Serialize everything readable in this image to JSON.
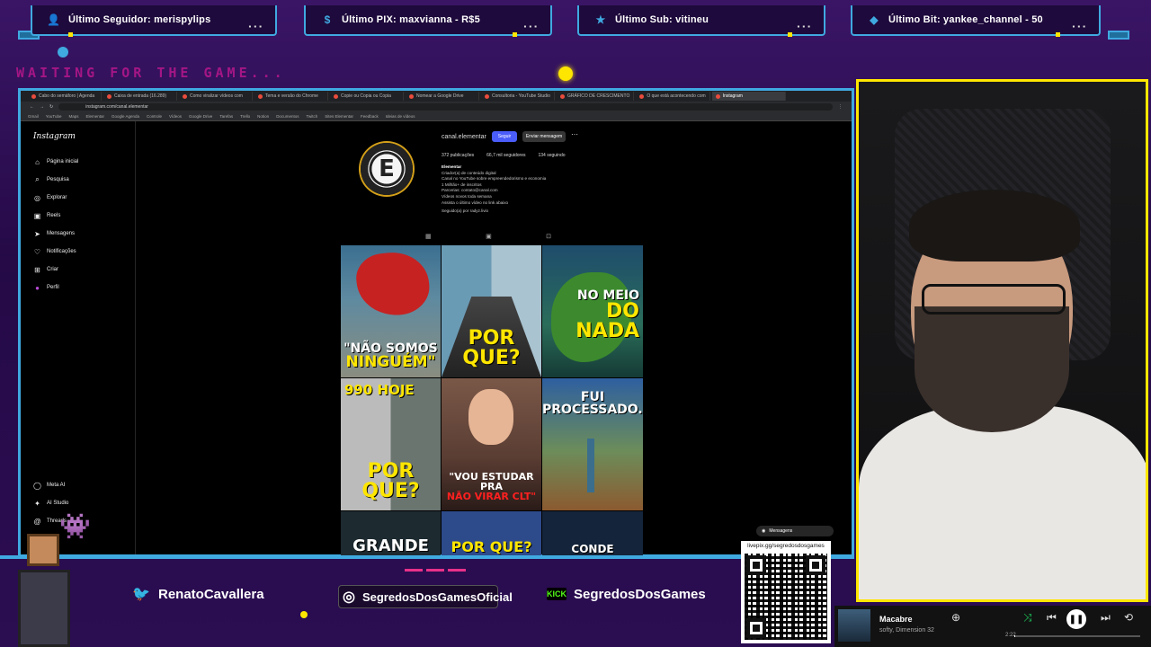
{
  "alerts": {
    "follower": {
      "label": "Último Seguidor: merispylips",
      "icon": "user-icon"
    },
    "pix": {
      "label": "Último PIX: maxvianna - R$5",
      "icon": "dollar-icon"
    },
    "sub": {
      "label": "Último Sub: vitineu",
      "icon": "star-icon"
    },
    "bit": {
      "label": "Último Bit: yankee_channel - 50",
      "icon": "diamond-icon"
    }
  },
  "overlay": {
    "waiting_text": "WAITING FOR THE GAME..."
  },
  "browser": {
    "tabs": [
      {
        "label": "Cabo do semáforo | Agenda",
        "active": false
      },
      {
        "label": "Caixa de entrada (16.289)",
        "active": false
      },
      {
        "label": "Como viralizar vídeos com",
        "active": false
      },
      {
        "label": "Tema e versão do Chrome",
        "active": false
      },
      {
        "label": "Copie ou Copia ou Copia",
        "active": false
      },
      {
        "label": "Nomear a Google Drive",
        "active": false
      },
      {
        "label": "Consultoria - YouTube Studio",
        "active": false
      },
      {
        "label": "GRÁFICO DE CRESCIMENTO",
        "active": false
      },
      {
        "label": "O que está acontecendo com",
        "active": false
      },
      {
        "label": "Instagram",
        "active": true
      }
    ],
    "url": "instagram.com/canal.elementar",
    "bookmarks": [
      "Gmail",
      "YouTube",
      "Maps",
      "Elementar",
      "Google Agenda",
      "Controle",
      "Vídeos",
      "Google Drive",
      "Tarefas",
      "Trello",
      "Notion",
      "Documentos",
      "Twitch",
      "Sites Elementar",
      "Feedback",
      "Ideias de vídeos"
    ]
  },
  "instagram": {
    "logo": "Instagram",
    "nav": [
      {
        "label": "Página inicial",
        "icon": "home-icon"
      },
      {
        "label": "Pesquisa",
        "icon": "search-icon"
      },
      {
        "label": "Explorar",
        "icon": "compass-icon"
      },
      {
        "label": "Reels",
        "icon": "reels-icon"
      },
      {
        "label": "Mensagens",
        "icon": "send-icon"
      },
      {
        "label": "Notificações",
        "icon": "heart-icon"
      },
      {
        "label": "Criar",
        "icon": "plus-icon"
      },
      {
        "label": "Perfil",
        "icon": "avatar-icon"
      }
    ],
    "bottom_nav": [
      {
        "label": "Meta AI",
        "icon": "meta-ai-icon"
      },
      {
        "label": "AI Studio",
        "icon": "ai-studio-icon"
      },
      {
        "label": "Threads",
        "icon": "threads-icon"
      }
    ],
    "profile": {
      "username": "canal.elementar",
      "avatar_letter": "E",
      "follow_label": "Seguir",
      "message_label": "Enviar mensagem",
      "posts": "372 publicações",
      "followers": "66,7 mil seguidores",
      "following": "134 seguindo",
      "bio": [
        "Elementar",
        "Criador(a) de conteúdo digital",
        "Canal no YouTube sobre empreendedorismo e economia",
        "1 Milhão+ de inscritos",
        "Parcerias: contato@canal.com",
        "Vídeos novos toda semana",
        "Assista o último vídeo no link abaixo"
      ],
      "followed_by": "Seguido(a) por radyz.livio"
    },
    "posts": [
      {
        "caption_white": "\"NÃO SOMOS",
        "caption_yellow": "NINGUÉM\""
      },
      {
        "caption_white": "",
        "caption_yellow": "POR QUE?"
      },
      {
        "caption_white": "NO MEIO",
        "caption_yellow": "DO NADA"
      },
      {
        "caption_white": "990      HOJE",
        "caption_yellow": "POR QUE?"
      },
      {
        "caption_white": "\"VOU ESTUDAR PRA",
        "caption_yellow": "NÃO VIRAR CLT\""
      },
      {
        "caption_white": "FUI PROCESSADO..",
        "caption_yellow": ""
      },
      {
        "caption_white": "GRANDE",
        "caption_yellow": ""
      },
      {
        "caption_white": "",
        "caption_yellow": "POR QUE?"
      },
      {
        "caption_white": "CONDE",
        "caption_yellow": ""
      }
    ],
    "messages_label": "Mensagens"
  },
  "socials": {
    "twitter": "RenatoCavallera",
    "instagram": "SegredosDosGamesOficial",
    "kick_badge": "KICK",
    "kick": "SegredosDosGames"
  },
  "qr": {
    "url": "livepix.gg/segredosdosgames"
  },
  "player": {
    "song": "Macabre",
    "artist": "softy, Dimension 32",
    "elapsed": "2:22",
    "progress": 0.01
  },
  "colors": {
    "accent": "#3fa9e0",
    "highlight": "#ffe600",
    "background": "#2a0f4e",
    "pink": "#e8318a"
  }
}
